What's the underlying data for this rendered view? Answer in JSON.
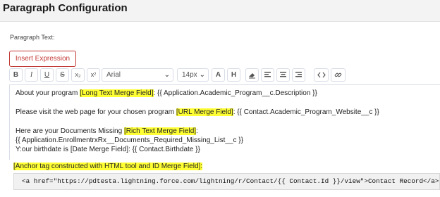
{
  "header": {
    "title": "Paragraph Configuration"
  },
  "paragraph_label": "Paragraph Text:",
  "insert_expression_label": "Insert Expression",
  "toolbar": {
    "bold": "B",
    "italic": "I",
    "underline": "U",
    "strike": "S",
    "subscript": "x₂",
    "superscript": "x²",
    "font_family": "Arial",
    "font_size": "14px",
    "text_color": "A",
    "highlight": "H",
    "chevron": "⌄"
  },
  "editor": {
    "line1_text": "About your program ",
    "line1_tag": "[Long Text Merge Field]",
    "line1_expr": ":  {{ Application.Academic_Program__c.Description }}",
    "line2_text": "Please visit the web page for your chosen program ",
    "line2_tag": "[URL Merge Field]",
    "line2_expr": ":  {{ Contact.Academic_Program_Website__c }}",
    "line3_text": "Here are your Documents Missing ",
    "line3_tag": "[Rich Text Merge Field]",
    "line3_colon": ":",
    "line4": "{{ Application.EnrollmentrxRx__Documents_Required_Missing_List__c }}",
    "line5": "Y:our birthdate is [Date Merge Field]:  {{ Contact.Birthdate }}"
  },
  "anchor_label": "[Anchor tag constructed with HTML tool and ID Merge Field]:",
  "anchor_code": "<a href=\"https://pdtesta.lightning.force.com/lightning/r/Contact/{{ Contact.Id }}/view\">Contact Record</a>",
  "colors": {
    "accent_red": "#c23934",
    "highlight": "#ffff33"
  }
}
